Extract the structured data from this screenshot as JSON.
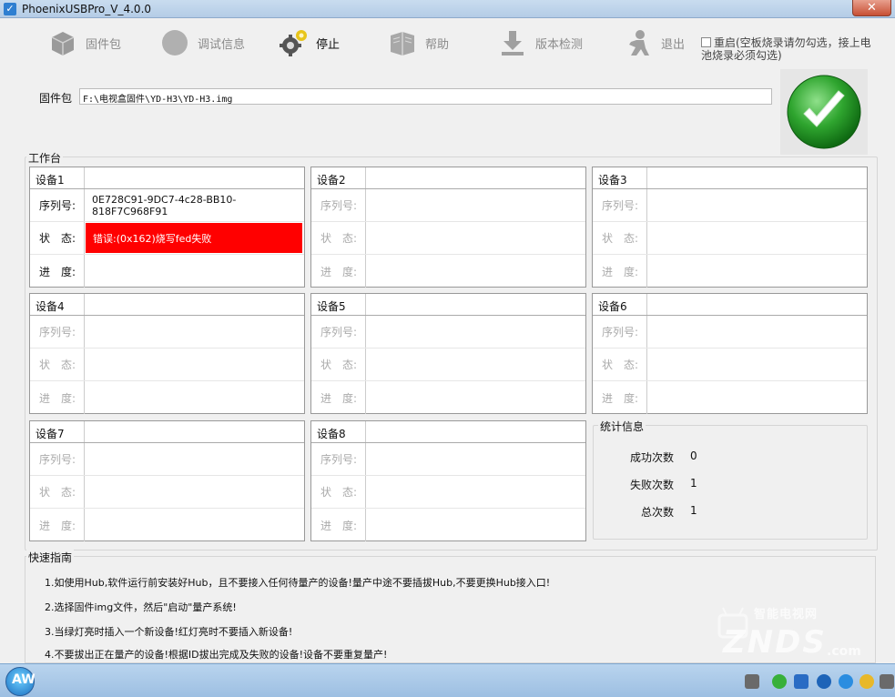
{
  "window": {
    "title": "PhoenixUSBPro_V_4.0.0"
  },
  "toolbar": [
    {
      "label": "固件包",
      "icon": "package-icon",
      "active": false
    },
    {
      "label": "调试信息",
      "icon": "debug-circle-icon",
      "active": false
    },
    {
      "label": "停止",
      "icon": "gears-icon",
      "active": true
    },
    {
      "label": "帮助",
      "icon": "help-book-icon",
      "active": false
    },
    {
      "label": "版本检测",
      "icon": "download-check-icon",
      "active": false
    },
    {
      "label": "退出",
      "icon": "exit-person-icon",
      "active": false
    }
  ],
  "reboot_checkbox": {
    "label": "重启(空板烧录请勿勾选，接上电池烧录必须勾选)",
    "checked": false
  },
  "firmware": {
    "label": "固件包",
    "path": "F:\\电视盒固件\\YD-H3\\YD-H3.img"
  },
  "workbench": {
    "title": "工作台",
    "row_labels": {
      "serial": "序列号:",
      "status": "状　态:",
      "progress": "进　度:"
    },
    "devices": [
      {
        "name": "设备1",
        "serial": "0E728C91-9DC7-4c28-BB10-818F7C968F91",
        "status": "错误:(0x162)烧写fed失败",
        "progress": "",
        "status_color": "#ff0000"
      },
      {
        "name": "设备2",
        "serial": "",
        "status": "",
        "progress": ""
      },
      {
        "name": "设备3",
        "serial": "",
        "status": "",
        "progress": ""
      },
      {
        "name": "设备4",
        "serial": "",
        "status": "",
        "progress": ""
      },
      {
        "name": "设备5",
        "serial": "",
        "status": "",
        "progress": ""
      },
      {
        "name": "设备6",
        "serial": "",
        "status": "",
        "progress": ""
      },
      {
        "name": "设备7",
        "serial": "",
        "status": "",
        "progress": ""
      },
      {
        "name": "设备8",
        "serial": "",
        "status": "",
        "progress": ""
      }
    ]
  },
  "stats": {
    "title": "统计信息",
    "success_label": "成功次数",
    "success": "0",
    "fail_label": "失败次数",
    "fail": "1",
    "total_label": "总次数",
    "total": "1"
  },
  "guide": {
    "title": "快速指南",
    "lines": [
      "1.如使用Hub,软件运行前安装好Hub，且不要接入任何待量产的设备!量产中途不要插拔Hub,不要更换Hub接入口!",
      "2.选择固件img文件，然后\"启动\"量产系统!",
      "3.当绿灯亮时插入一个新设备!红灯亮时不要插入新设备!",
      "4.不要拔出正在量产的设备!根据ID拔出完成及失败的设备!设备不要重复量产!"
    ]
  },
  "watermark": {
    "text": "ZNDS",
    "sub": "智能电视网",
    "domain": ".com"
  },
  "colors": {
    "accent_green": "#2fa52f",
    "error_red": "#ff0000"
  }
}
